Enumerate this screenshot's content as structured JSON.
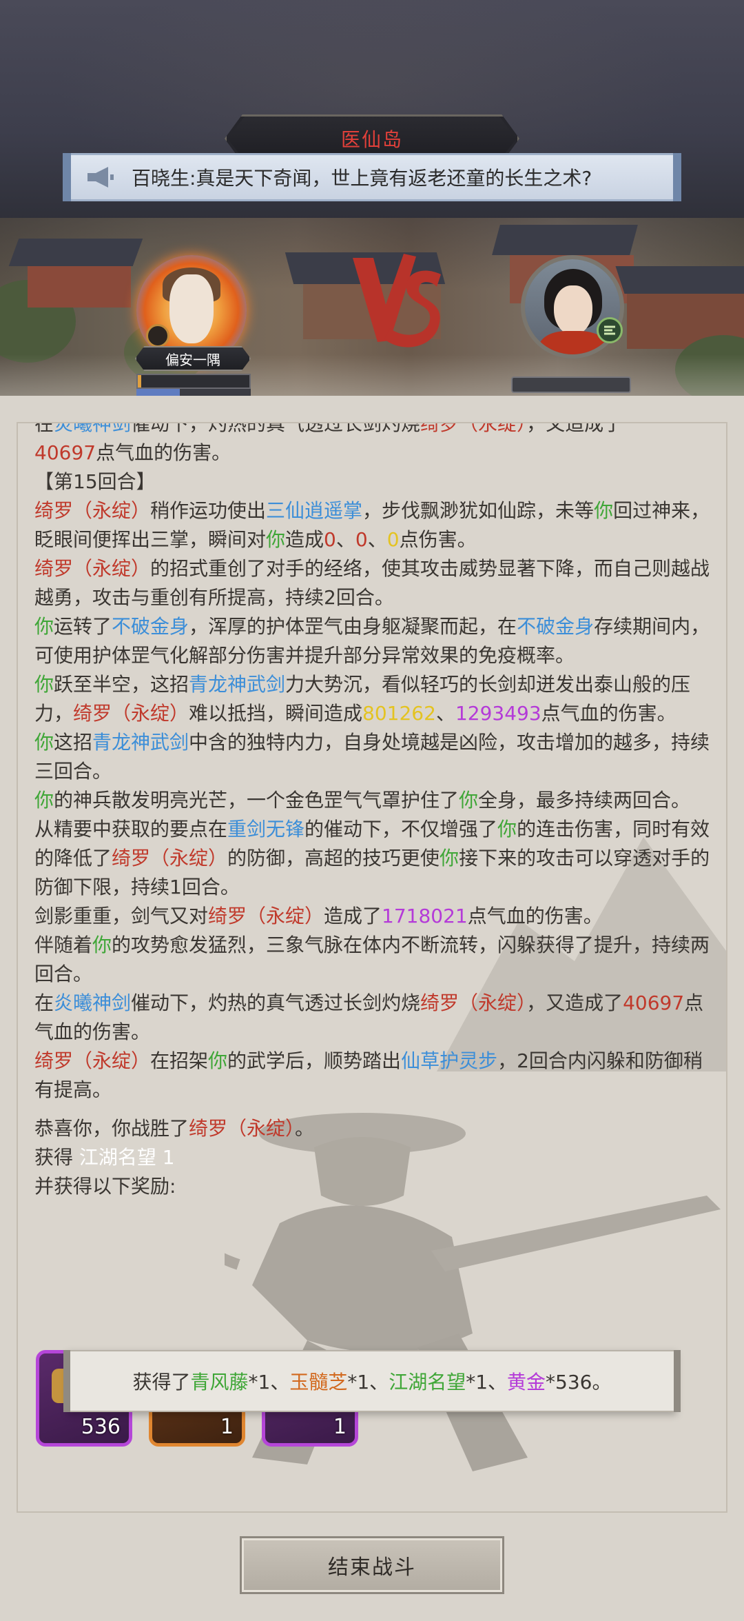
{
  "header": {
    "location": "医仙岛",
    "announcement": "百晓生:真是天下奇闻，世上竟有返老还童的长生之术?"
  },
  "battle": {
    "player_name": "偏安一隅",
    "player_hp_fraction": 0.03,
    "player_mp_fraction": 0.38,
    "opponent_hp_fraction": 0.0,
    "vs_label": "VS"
  },
  "log": {
    "cut_line": [
      {
        "t": "在",
        "c": ""
      },
      {
        "t": "炎曦神剑",
        "c": "blue"
      },
      {
        "t": "催动下，灼热的真气透过长剑灼烧",
        "c": ""
      },
      {
        "t": "绮罗（永绽）",
        "c": "red"
      },
      {
        "t": "，又造成了",
        "c": ""
      }
    ],
    "entries": [
      [
        {
          "t": "40697",
          "c": "red"
        },
        {
          "t": "点气血的伤害。",
          "c": ""
        }
      ],
      [
        {
          "t": "【第15回合】",
          "c": ""
        }
      ],
      [
        {
          "t": "绮罗（永绽）",
          "c": "red"
        },
        {
          "t": "稍作运功使出",
          "c": ""
        },
        {
          "t": "三仙逍遥掌",
          "c": "blue"
        },
        {
          "t": "，步伐飘渺犹如仙踪，未等",
          "c": ""
        },
        {
          "t": "你",
          "c": "green"
        },
        {
          "t": "回过神来，眨眼间便挥出三掌，瞬间对",
          "c": ""
        },
        {
          "t": "你",
          "c": "green"
        },
        {
          "t": "造成",
          "c": ""
        },
        {
          "t": "0",
          "c": "red"
        },
        {
          "t": "、",
          "c": ""
        },
        {
          "t": "0",
          "c": "red"
        },
        {
          "t": "、",
          "c": ""
        },
        {
          "t": "0",
          "c": "yellow"
        },
        {
          "t": "点伤害。",
          "c": ""
        }
      ],
      [
        {
          "t": "绮罗（永绽）",
          "c": "red"
        },
        {
          "t": "的招式重创了对手的经络，使其攻击威势显著下降，而自己则越战越勇，攻击与重创有所提高，持续2回合。",
          "c": ""
        }
      ],
      [
        {
          "t": "你",
          "c": "green"
        },
        {
          "t": "运转了",
          "c": ""
        },
        {
          "t": "不破金身",
          "c": "blue"
        },
        {
          "t": "，浑厚的护体罡气由身躯凝聚而起，在",
          "c": ""
        },
        {
          "t": "不破金身",
          "c": "blue"
        },
        {
          "t": "存续期间内，可使用护体罡气化解部分伤害并提升部分异常效果的免疫概率。",
          "c": ""
        }
      ],
      [
        {
          "t": "你",
          "c": "green"
        },
        {
          "t": "跃至半空，这招",
          "c": ""
        },
        {
          "t": "青龙神武剑",
          "c": "blue"
        },
        {
          "t": "力大势沉，看似轻巧的长剑却迸发出泰山般的压力，",
          "c": ""
        },
        {
          "t": "绮罗（永绽）",
          "c": "red"
        },
        {
          "t": "难以抵挡，瞬间造成",
          "c": ""
        },
        {
          "t": "801262",
          "c": "yellow"
        },
        {
          "t": "、",
          "c": ""
        },
        {
          "t": "1293493",
          "c": "purple"
        },
        {
          "t": "点气血的伤害。",
          "c": ""
        }
      ],
      [
        {
          "t": "你",
          "c": "green"
        },
        {
          "t": "这招",
          "c": ""
        },
        {
          "t": "青龙神武剑",
          "c": "blue"
        },
        {
          "t": "中含的独特内力，自身处境越是凶险，攻击增加的越多，持续三回合。",
          "c": ""
        }
      ],
      [
        {
          "t": "你",
          "c": "green"
        },
        {
          "t": "的神兵散发明亮光芒，一个金色罡气气罩护住了",
          "c": ""
        },
        {
          "t": "你",
          "c": "green"
        },
        {
          "t": "全身，最多持续两回合。",
          "c": ""
        }
      ],
      [
        {
          "t": "从精要中获取的要点在",
          "c": ""
        },
        {
          "t": "重剑无锋",
          "c": "blue"
        },
        {
          "t": "的催动下，不仅增强了",
          "c": ""
        },
        {
          "t": "你",
          "c": "green"
        },
        {
          "t": "的连击伤害，同时有效的降低了",
          "c": ""
        },
        {
          "t": "绮罗（永绽）",
          "c": "red"
        },
        {
          "t": "的防御，高超的技巧更使",
          "c": ""
        },
        {
          "t": "你",
          "c": "green"
        },
        {
          "t": "接下来的攻击可以穿透对手的防御下限，持续1回合。",
          "c": ""
        }
      ],
      [
        {
          "t": "剑影重重，剑气又对",
          "c": ""
        },
        {
          "t": "绮罗（永绽）",
          "c": "red"
        },
        {
          "t": "造成了",
          "c": ""
        },
        {
          "t": "1718021",
          "c": "purple"
        },
        {
          "t": "点气血的伤害。",
          "c": ""
        }
      ],
      [
        {
          "t": "伴随着",
          "c": ""
        },
        {
          "t": "你",
          "c": "green"
        },
        {
          "t": "的攻势愈发猛烈，三象气脉在体内不断流转，闪躲获得了提升，持续两回合。",
          "c": ""
        }
      ],
      [
        {
          "t": "在",
          "c": ""
        },
        {
          "t": "炎曦神剑",
          "c": "blue"
        },
        {
          "t": "催动下，灼热的真气透过长剑灼烧",
          "c": ""
        },
        {
          "t": "绮罗（永绽）",
          "c": "red"
        },
        {
          "t": "，又造成了",
          "c": ""
        },
        {
          "t": "40697",
          "c": "red"
        },
        {
          "t": "点气血的伤害。",
          "c": ""
        }
      ],
      [
        {
          "t": "绮罗（永绽）",
          "c": "red"
        },
        {
          "t": "在招架",
          "c": ""
        },
        {
          "t": "你",
          "c": "green"
        },
        {
          "t": "的武学后，顺势踏出",
          "c": ""
        },
        {
          "t": "仙草护灵步",
          "c": "blue"
        },
        {
          "t": "，2回合内闪躲和防御稍有提高。",
          "c": ""
        }
      ]
    ],
    "victory": [
      {
        "t": "恭喜你，你战胜了",
        "c": ""
      },
      {
        "t": "绮罗（永绽）",
        "c": "red"
      },
      {
        "t": "。",
        "c": ""
      }
    ],
    "gain_label": "获得",
    "gain_value": "江湖名望 1",
    "rewards_label": "并获得以下奖励:"
  },
  "rewards": [
    {
      "count": "536",
      "rarity": "purple",
      "icon": "gold-ingot-icon"
    },
    {
      "count": "1",
      "rarity": "orange",
      "icon": "herb-icon"
    },
    {
      "count": "1",
      "rarity": "purple",
      "icon": "herb-icon"
    }
  ],
  "toast": [
    {
      "t": "获得了",
      "c": ""
    },
    {
      "t": "青风藤",
      "c": "green"
    },
    {
      "t": "*1、",
      "c": ""
    },
    {
      "t": "玉髓芝",
      "c": "orange"
    },
    {
      "t": "*1、",
      "c": ""
    },
    {
      "t": "江湖名望",
      "c": "green"
    },
    {
      "t": "*1、",
      "c": ""
    },
    {
      "t": "黄金",
      "c": "purple"
    },
    {
      "t": "*536。",
      "c": ""
    }
  ],
  "end_button": "结束战斗",
  "colors": {
    "red": "#c0392b",
    "blue": "#3c8ed8",
    "green": "#3fa637",
    "yellow": "#e4c321",
    "purple": "#b43ad8",
    "orange": "#d2691e"
  }
}
